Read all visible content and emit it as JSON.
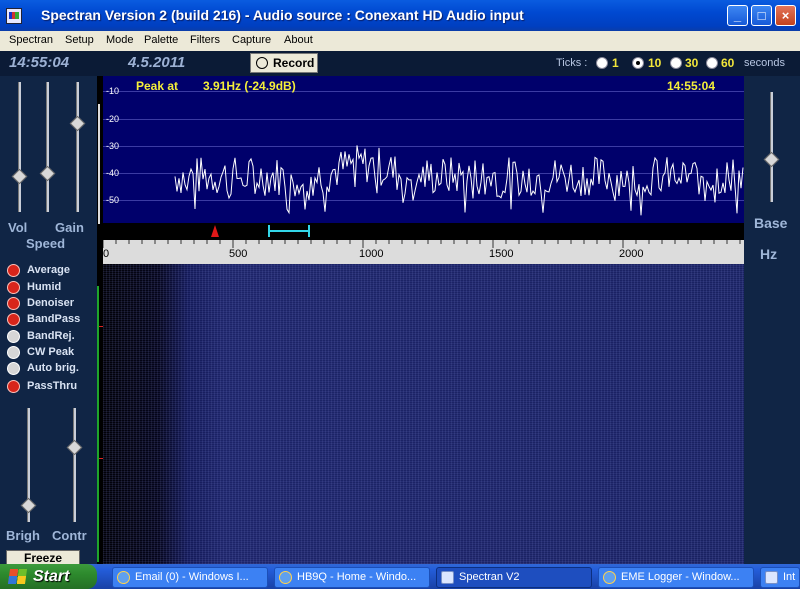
{
  "window": {
    "title": "Spectran Version 2 (build 216) - Audio source  :  Conexant HD Audio input"
  },
  "menu": [
    "Spectran",
    "Setup",
    "Mode",
    "Palette",
    "Filters",
    "Capture",
    "About"
  ],
  "infobar": {
    "time": "14:55:04",
    "date": "4.5.2011",
    "record_label": "Record",
    "ticks_label": "Ticks :",
    "tick_options": [
      "1",
      "10",
      "30",
      "60"
    ],
    "tick_selected": "10",
    "seconds_label": "seconds"
  },
  "left_panel": {
    "vol_label": "Vol",
    "gain_label": "Gain",
    "speed_label": "Speed",
    "brigh_label": "Brigh",
    "contr_label": "Contr",
    "freeze_label": "Freeze",
    "options": [
      {
        "label": "Average",
        "on": true
      },
      {
        "label": "Humid",
        "on": true
      },
      {
        "label": "Denoiser",
        "on": true
      },
      {
        "label": "BandPass",
        "on": true
      },
      {
        "label": "BandRej.",
        "on": false
      },
      {
        "label": "CW Peak",
        "on": false
      },
      {
        "label": "Auto brig.",
        "on": false
      },
      {
        "label": "PassThru",
        "on": true
      }
    ]
  },
  "right_panel": {
    "base_label": "Base",
    "unit_label": "Hz"
  },
  "spectrum": {
    "peak_label": "Peak at",
    "peak_value": "3.91Hz (-24.9dB)",
    "time": "14:55:04",
    "db_ticks": [
      "-10",
      "-20",
      "-30",
      "-40",
      "-50"
    ],
    "freq_ticks": [
      "0",
      "500",
      "1000",
      "1500",
      "2000"
    ],
    "colors": {
      "background": "#00006b",
      "trace": "#ffffff",
      "label": "#f5ef3a",
      "bandpass": "#33d6e8",
      "marker": "#e01818"
    }
  },
  "taskbar": {
    "start_label": "Start",
    "tasks": [
      {
        "label": "Email (0) - Windows I...",
        "icon": "ie-icon",
        "active": false
      },
      {
        "label": "HB9Q - Home - Windo...",
        "icon": "ie-icon",
        "active": false
      },
      {
        "label": "Spectran V2",
        "icon": "app-icon",
        "active": true
      },
      {
        "label": "EME Logger - Window...",
        "icon": "ie-icon",
        "active": false
      },
      {
        "label": "Int",
        "icon": "app-icon",
        "active": false
      }
    ]
  }
}
